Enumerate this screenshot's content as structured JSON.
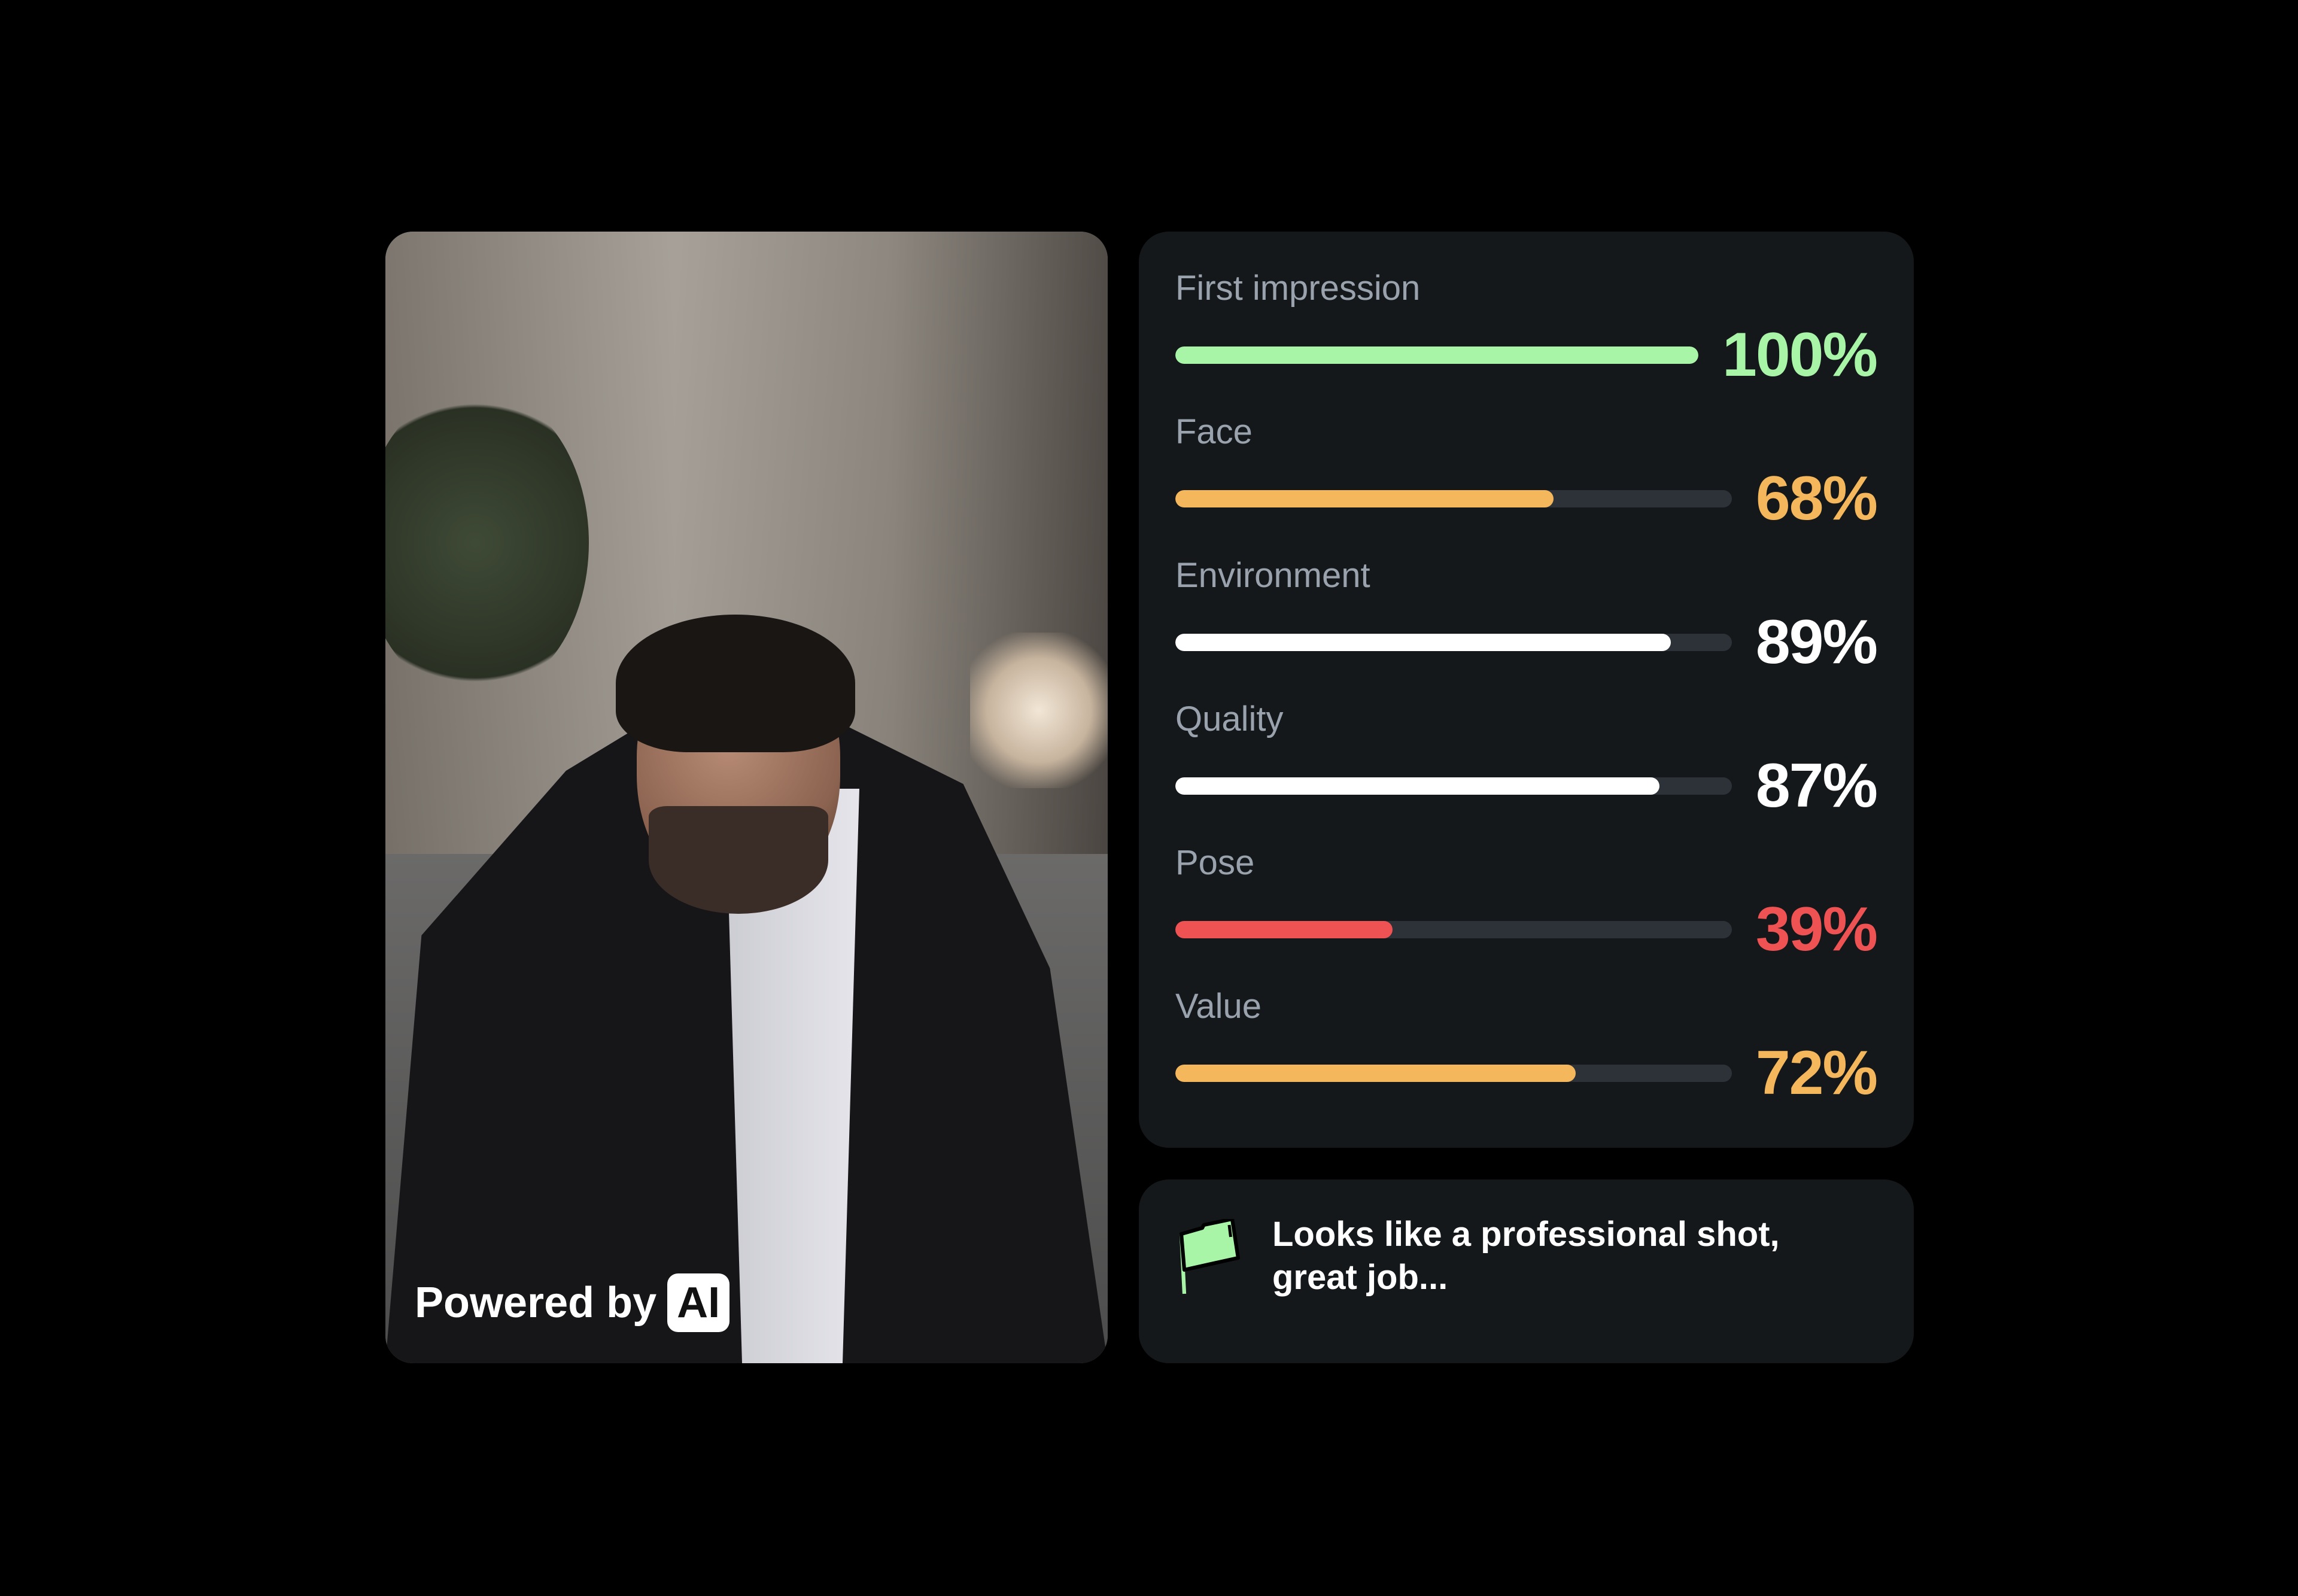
{
  "photo": {
    "powered_by": "Powered by",
    "badge": "AI"
  },
  "colors": {
    "green": "#a8f5a8",
    "orange": "#f5b75c",
    "white": "#ffffff",
    "red": "#ee5253",
    "track": "#2d3238",
    "card": "#15181b",
    "label": "#9aa3ad"
  },
  "scores": [
    {
      "label": "First impression",
      "value": 100,
      "display": "100%",
      "color": "#a8f5a8"
    },
    {
      "label": "Face",
      "value": 68,
      "display": "68%",
      "color": "#f5b75c"
    },
    {
      "label": "Environment",
      "value": 89,
      "display": "89%",
      "color": "#ffffff"
    },
    {
      "label": "Quality",
      "value": 87,
      "display": "87%",
      "color": "#ffffff"
    },
    {
      "label": "Pose",
      "value": 39,
      "display": "39%",
      "color": "#ee5253"
    },
    {
      "label": "Value",
      "value": 72,
      "display": "72%",
      "color": "#f5b75c"
    }
  ],
  "message": {
    "icon": "flag-icon",
    "line1": "Looks like a professional shot,",
    "line2": "great job..."
  }
}
